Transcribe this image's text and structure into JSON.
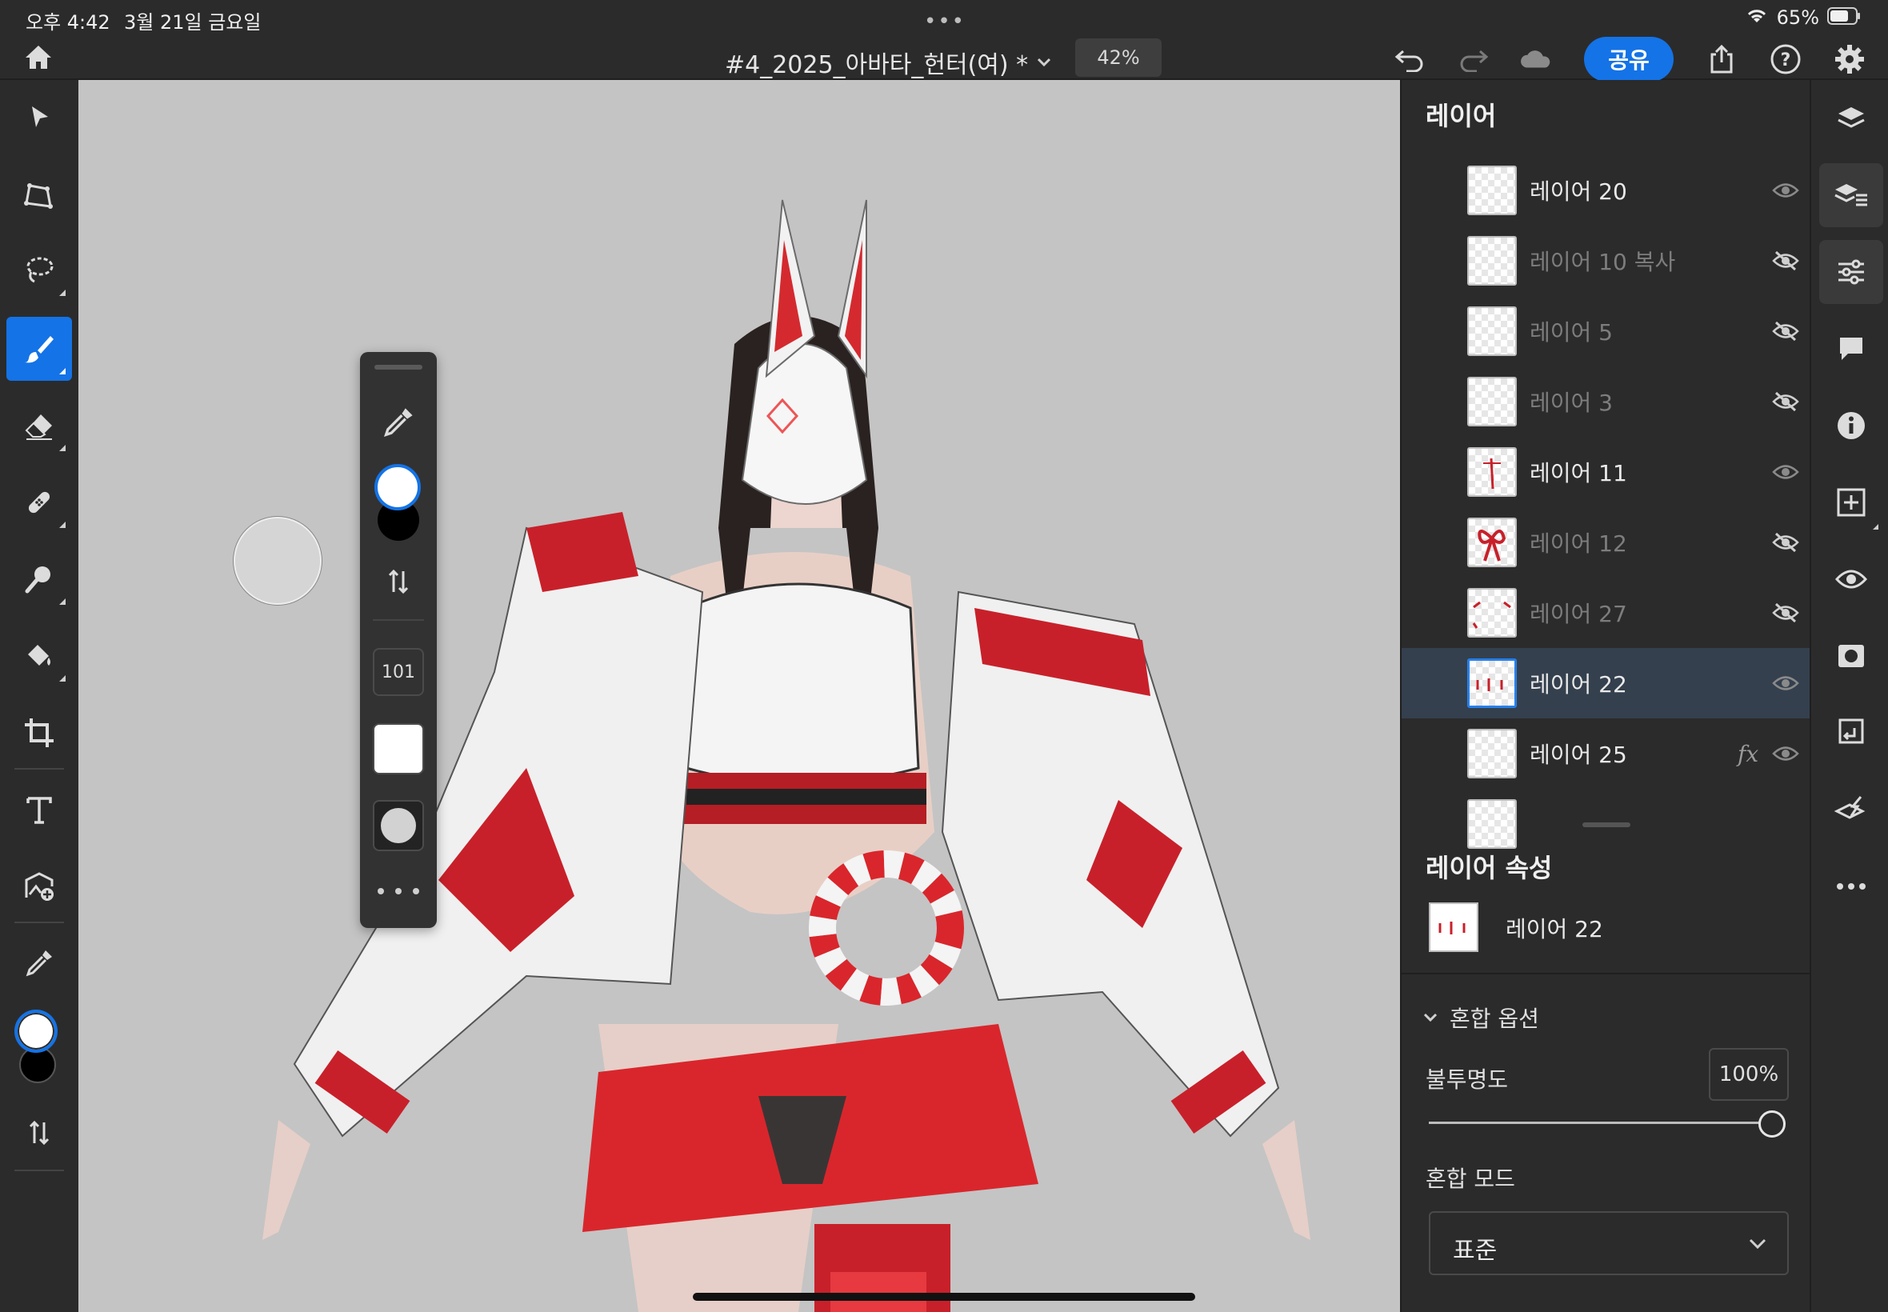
{
  "status": {
    "time": "오후 4:42",
    "date": "3월 21일 금요일",
    "dots": "•••",
    "battery": "65%"
  },
  "toolbar": {
    "title": "#4_2025_아바타_헌터(여) *",
    "zoom": "42%",
    "share_label": "공유"
  },
  "brush_panel": {
    "size": "101"
  },
  "layers_panel": {
    "title": "레이어",
    "layers": [
      {
        "name": "레이어 20",
        "visible": true,
        "selected": false
      },
      {
        "name": "레이어 10 복사",
        "visible": false,
        "selected": false
      },
      {
        "name": "레이어 5",
        "visible": false,
        "selected": false
      },
      {
        "name": "레이어 3",
        "visible": false,
        "selected": false
      },
      {
        "name": "레이어 11",
        "visible": true,
        "selected": false
      },
      {
        "name": "레이어 12",
        "visible": false,
        "selected": false
      },
      {
        "name": "레이어 27",
        "visible": false,
        "selected": false
      },
      {
        "name": "레이어 22",
        "visible": true,
        "selected": true
      },
      {
        "name": "레이어 25",
        "visible": true,
        "selected": false,
        "fx": "fx"
      }
    ]
  },
  "properties": {
    "title": "레이어 속성",
    "layer_name": "레이어 22",
    "blend_options": "혼합 옵션",
    "opacity_label": "불투명도",
    "opacity_value": "100%",
    "opacity_fraction": 1.0,
    "blend_mode_label": "혼합 모드",
    "blend_mode_value": "표준"
  },
  "colors": {
    "accent": "#1473e6",
    "panel": "#2b2b2b",
    "canvas": "#c4c4c4",
    "selected_row": "#34404e"
  }
}
